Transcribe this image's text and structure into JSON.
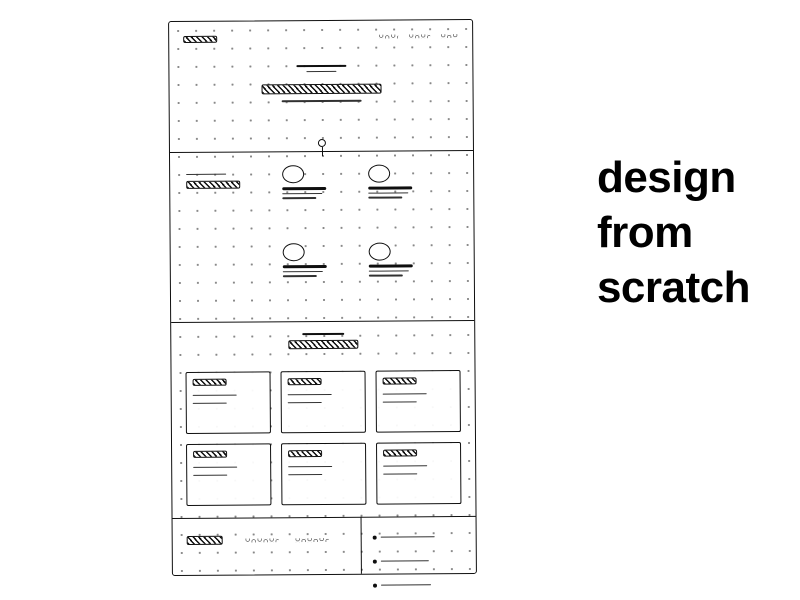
{
  "caption": {
    "line1": "design",
    "line2": "from",
    "line3": "scratch"
  },
  "wireframe": {
    "description": "hand-sketched landing-page wireframe on dotted grid",
    "hero": {
      "logo_placeholder": "logo",
      "nav_items": 3,
      "eyebrow_text": "eyebrow",
      "headline_block": "headline",
      "subline_text": "subline"
    },
    "features": {
      "side_label_1": "label",
      "side_label_2": "label bold",
      "items": [
        {
          "icon": "circle",
          "title": "title",
          "lines": 2
        },
        {
          "icon": "circle",
          "title": "title",
          "lines": 2
        },
        {
          "icon": "circle",
          "title": "title",
          "lines": 2
        },
        {
          "icon": "circle",
          "title": "title",
          "lines": 2
        }
      ]
    },
    "cards_section": {
      "eyebrow": "eyebrow",
      "title_block": "title",
      "cards": [
        {
          "title": "card",
          "lines": 2
        },
        {
          "title": "card",
          "lines": 2
        },
        {
          "title": "card",
          "lines": 2
        },
        {
          "title": "card",
          "lines": 2
        },
        {
          "title": "card",
          "lines": 2
        },
        {
          "title": "card",
          "lines": 2
        }
      ]
    },
    "footer": {
      "logo": "logo",
      "nav_groups": 2,
      "bullets": 3
    }
  }
}
